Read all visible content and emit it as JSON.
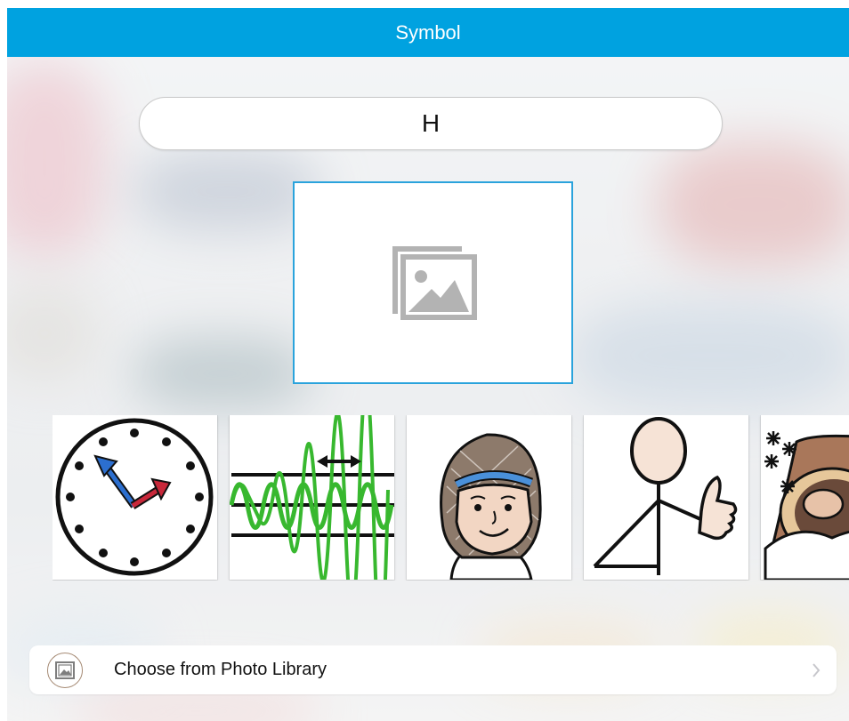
{
  "header": {
    "title": "Symbol"
  },
  "name_field": {
    "value": "H"
  },
  "preview": {
    "icon": "image-placeholder-icon"
  },
  "symbols": [
    {
      "name": "clock"
    },
    {
      "name": "frequency-waves"
    },
    {
      "name": "girl-with-headband"
    },
    {
      "name": "person-thumbs-up"
    },
    {
      "name": "hibernating-animal-snow"
    }
  ],
  "photo_library": {
    "label": "Choose from Photo Library",
    "icon": "photo-library-icon"
  },
  "colors": {
    "header": "#00a2e0",
    "preview_border": "#2aa3dc"
  }
}
